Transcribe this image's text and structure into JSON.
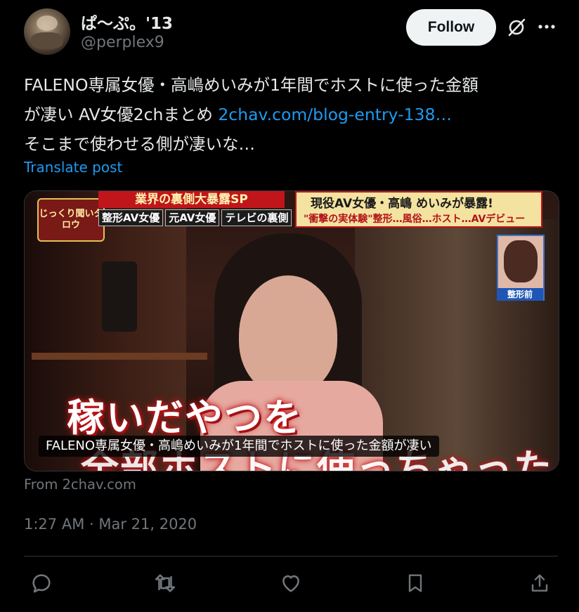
{
  "author": {
    "display_name": "ぱ〜ぷ。'13",
    "handle": "@perplex9",
    "avatar_icon": "avatar-image"
  },
  "header": {
    "follow_label": "Follow",
    "grok_icon": "grok-icon",
    "more_icon": "more-icon"
  },
  "post": {
    "line1": "FALENO専属女優・高嶋めいみが1年間でホストに使った金額",
    "line2_prefix": "が凄い AV女優2chまとめ ",
    "link_text": "2chav.com/blog-entry-138…",
    "line3": "そこまで使わせる側が凄いな…",
    "translate_label": "Translate post"
  },
  "card": {
    "title": "FALENO専属女優・高嶋めいみが1年間でホストに使った金額が凄い",
    "source": "From 2chav.com",
    "image": {
      "logo_text": "じっくり聞いタロウ",
      "banner_top": "業界の裏側大暴露SP",
      "tags": [
        "整形AV女優",
        "元AV女優",
        "テレビの裏側"
      ],
      "banner_right_line1": "現役AV女優・高嶋 めいみが暴露!",
      "banner_right_line2": "\"衝撃の実体験\"整形…風俗…ホスト…AVデビュー",
      "inset_label": "整形前",
      "caption_line1": "稼いだやつを",
      "caption_line2": "全部ホストに使っちゃった"
    }
  },
  "meta": {
    "timestamp": "1:27 AM · Mar 21, 2020"
  },
  "actions": [
    {
      "name": "reply-button",
      "icon": "reply-icon"
    },
    {
      "name": "repost-button",
      "icon": "repost-icon"
    },
    {
      "name": "like-button",
      "icon": "heart-icon"
    },
    {
      "name": "bookmark-button",
      "icon": "bookmark-icon"
    },
    {
      "name": "share-button",
      "icon": "share-icon"
    }
  ],
  "colors": {
    "background": "#000000",
    "text": "#e7e9ea",
    "secondary": "#71767b",
    "link": "#1d9bf0",
    "follow_bg": "#eff3f4"
  }
}
